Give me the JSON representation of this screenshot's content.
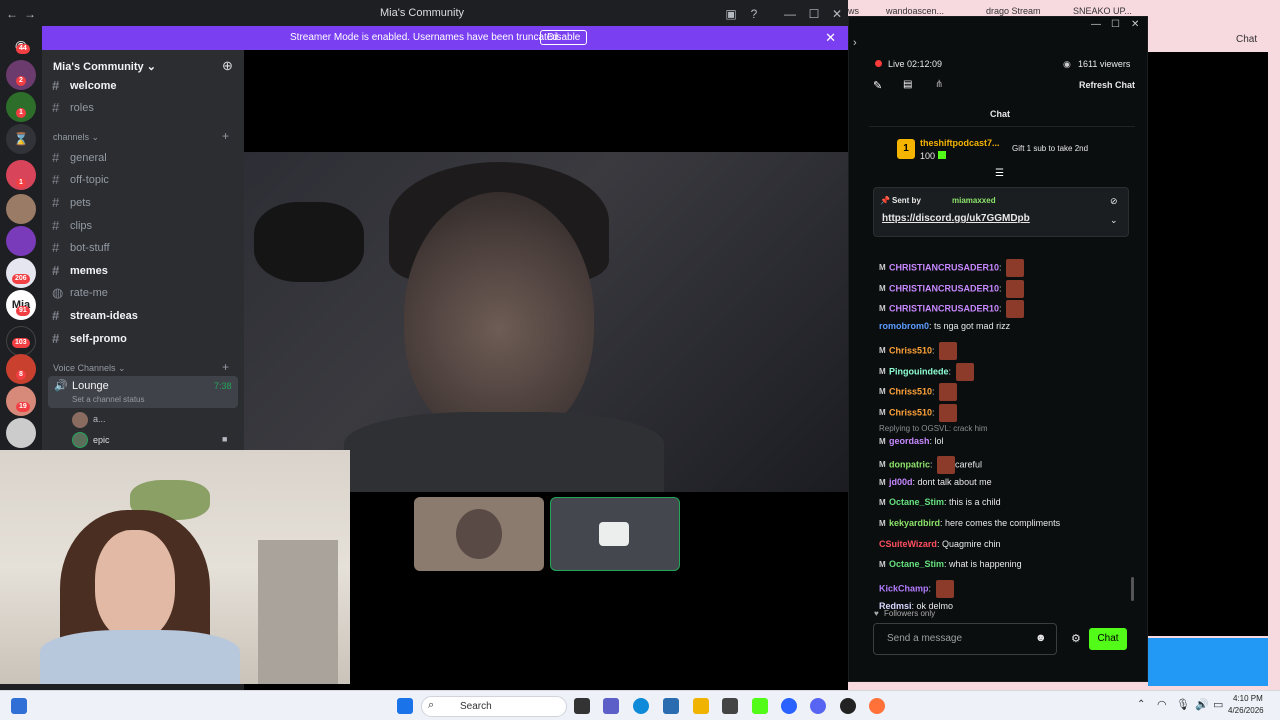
{
  "discord": {
    "window_title": "Mia's Community",
    "banner": {
      "message": "Streamer Mode is enabled. Usernames have been truncated.",
      "button": "Disable"
    },
    "server_name": "Mia's Community",
    "rail_badges": [
      "44",
      "2",
      "1",
      "1",
      "206",
      "91",
      "103",
      "8",
      "19"
    ],
    "channels_top": [
      {
        "name": "welcome"
      },
      {
        "name": "roles"
      }
    ],
    "category_channels": "channels",
    "channels": [
      {
        "name": "general"
      },
      {
        "name": "off-topic"
      },
      {
        "name": "pets"
      },
      {
        "name": "clips"
      },
      {
        "name": "bot-stuff"
      },
      {
        "name": "memes"
      },
      {
        "name": "rate-me"
      },
      {
        "name": "stream-ideas"
      },
      {
        "name": "self-promo"
      }
    ],
    "category_voice": "Voice Channels",
    "voice": {
      "name": "Lounge",
      "time": "7:38",
      "status": "Set a channel status",
      "users": [
        "a...",
        "epic"
      ]
    }
  },
  "browser": {
    "tabs": [
      "ws",
      "wandoascen...",
      "drago Stream",
      "SNEAKO UP..."
    ],
    "sidebar_label": "Chat"
  },
  "kick": {
    "live": "Live",
    "uptime": "02:12:09",
    "viewers": "1611 viewers",
    "refresh": "Refresh Chat",
    "chat_title": "Chat",
    "leader": {
      "rank": "1",
      "name": "theshiftpodcast7...",
      "amount": "100",
      "gift": "Gift 1 sub to take 2nd"
    },
    "pinned": {
      "sent_by": "Sent by",
      "user": "miamaxxed",
      "link": "https://discord.gg/uk7GGMDpb"
    },
    "messages": [
      {
        "user": "CHRISTIANCRUSADER10",
        "text": "",
        "color": "#c688ff",
        "mod": true,
        "emote": true
      },
      {
        "user": "CHRISTIANCRUSADER10",
        "text": "",
        "color": "#c688ff",
        "mod": true,
        "emote": true
      },
      {
        "user": "CHRISTIANCRUSADER10",
        "text": "",
        "color": "#c688ff",
        "mod": true,
        "emote": true
      },
      {
        "user": "romobrom0",
        "text": "ts nga got mad rizz",
        "color": "#5b9cff",
        "mod": false,
        "emote": false
      },
      {
        "user": "Chriss510",
        "text": "",
        "color": "#ffa33a",
        "mod": true,
        "emote": true
      },
      {
        "user": "Pingouindede",
        "text": "",
        "color": "#8effd4",
        "mod": true,
        "emote": true
      },
      {
        "user": "Chriss510",
        "text": "",
        "color": "#ffa33a",
        "mod": true,
        "emote": true
      },
      {
        "user": "Chriss510",
        "text": "",
        "color": "#ffa33a",
        "mod": true,
        "emote": true
      },
      {
        "reply": "Replying to OGSVL: crack him"
      },
      {
        "user": "geordash",
        "text": "lol",
        "color": "#c688ff",
        "mod": true,
        "emote": false
      },
      {
        "user": "donpatric",
        "text": "careful",
        "color": "#8ce36b",
        "mod": true,
        "emote": true
      },
      {
        "user": "jd00d",
        "text": "dont talk about me",
        "color": "#c688ff",
        "mod": true,
        "emote": false
      },
      {
        "user": "Octane_Stim",
        "text": "this is a child",
        "color": "#66e07f",
        "mod": true,
        "emote": false
      },
      {
        "user": "kekyardbird",
        "text": "here comes the compliments",
        "color": "#8ce36b",
        "mod": true,
        "emote": false
      },
      {
        "user": "CSuiteWizard",
        "text": "Quagmire chin",
        "color": "#ff4f5f",
        "mod": false,
        "emote": false
      },
      {
        "user": "Octane_Stim",
        "text": "what is happening",
        "color": "#66e07f",
        "mod": true,
        "emote": false
      },
      {
        "user": "KickChamp",
        "text": "",
        "color": "#b27bff",
        "mod": false,
        "emote": true
      },
      {
        "user": "Redmsi",
        "text": "ok delmo",
        "color": "#d8d8ff",
        "mod": false,
        "emote": false
      }
    ],
    "followers_only": "Followers only",
    "input_placeholder": "Send a message",
    "chat_button": "Chat"
  },
  "taskbar": {
    "search": "Search",
    "time": "4:10 PM",
    "date": "4/26/2026"
  }
}
